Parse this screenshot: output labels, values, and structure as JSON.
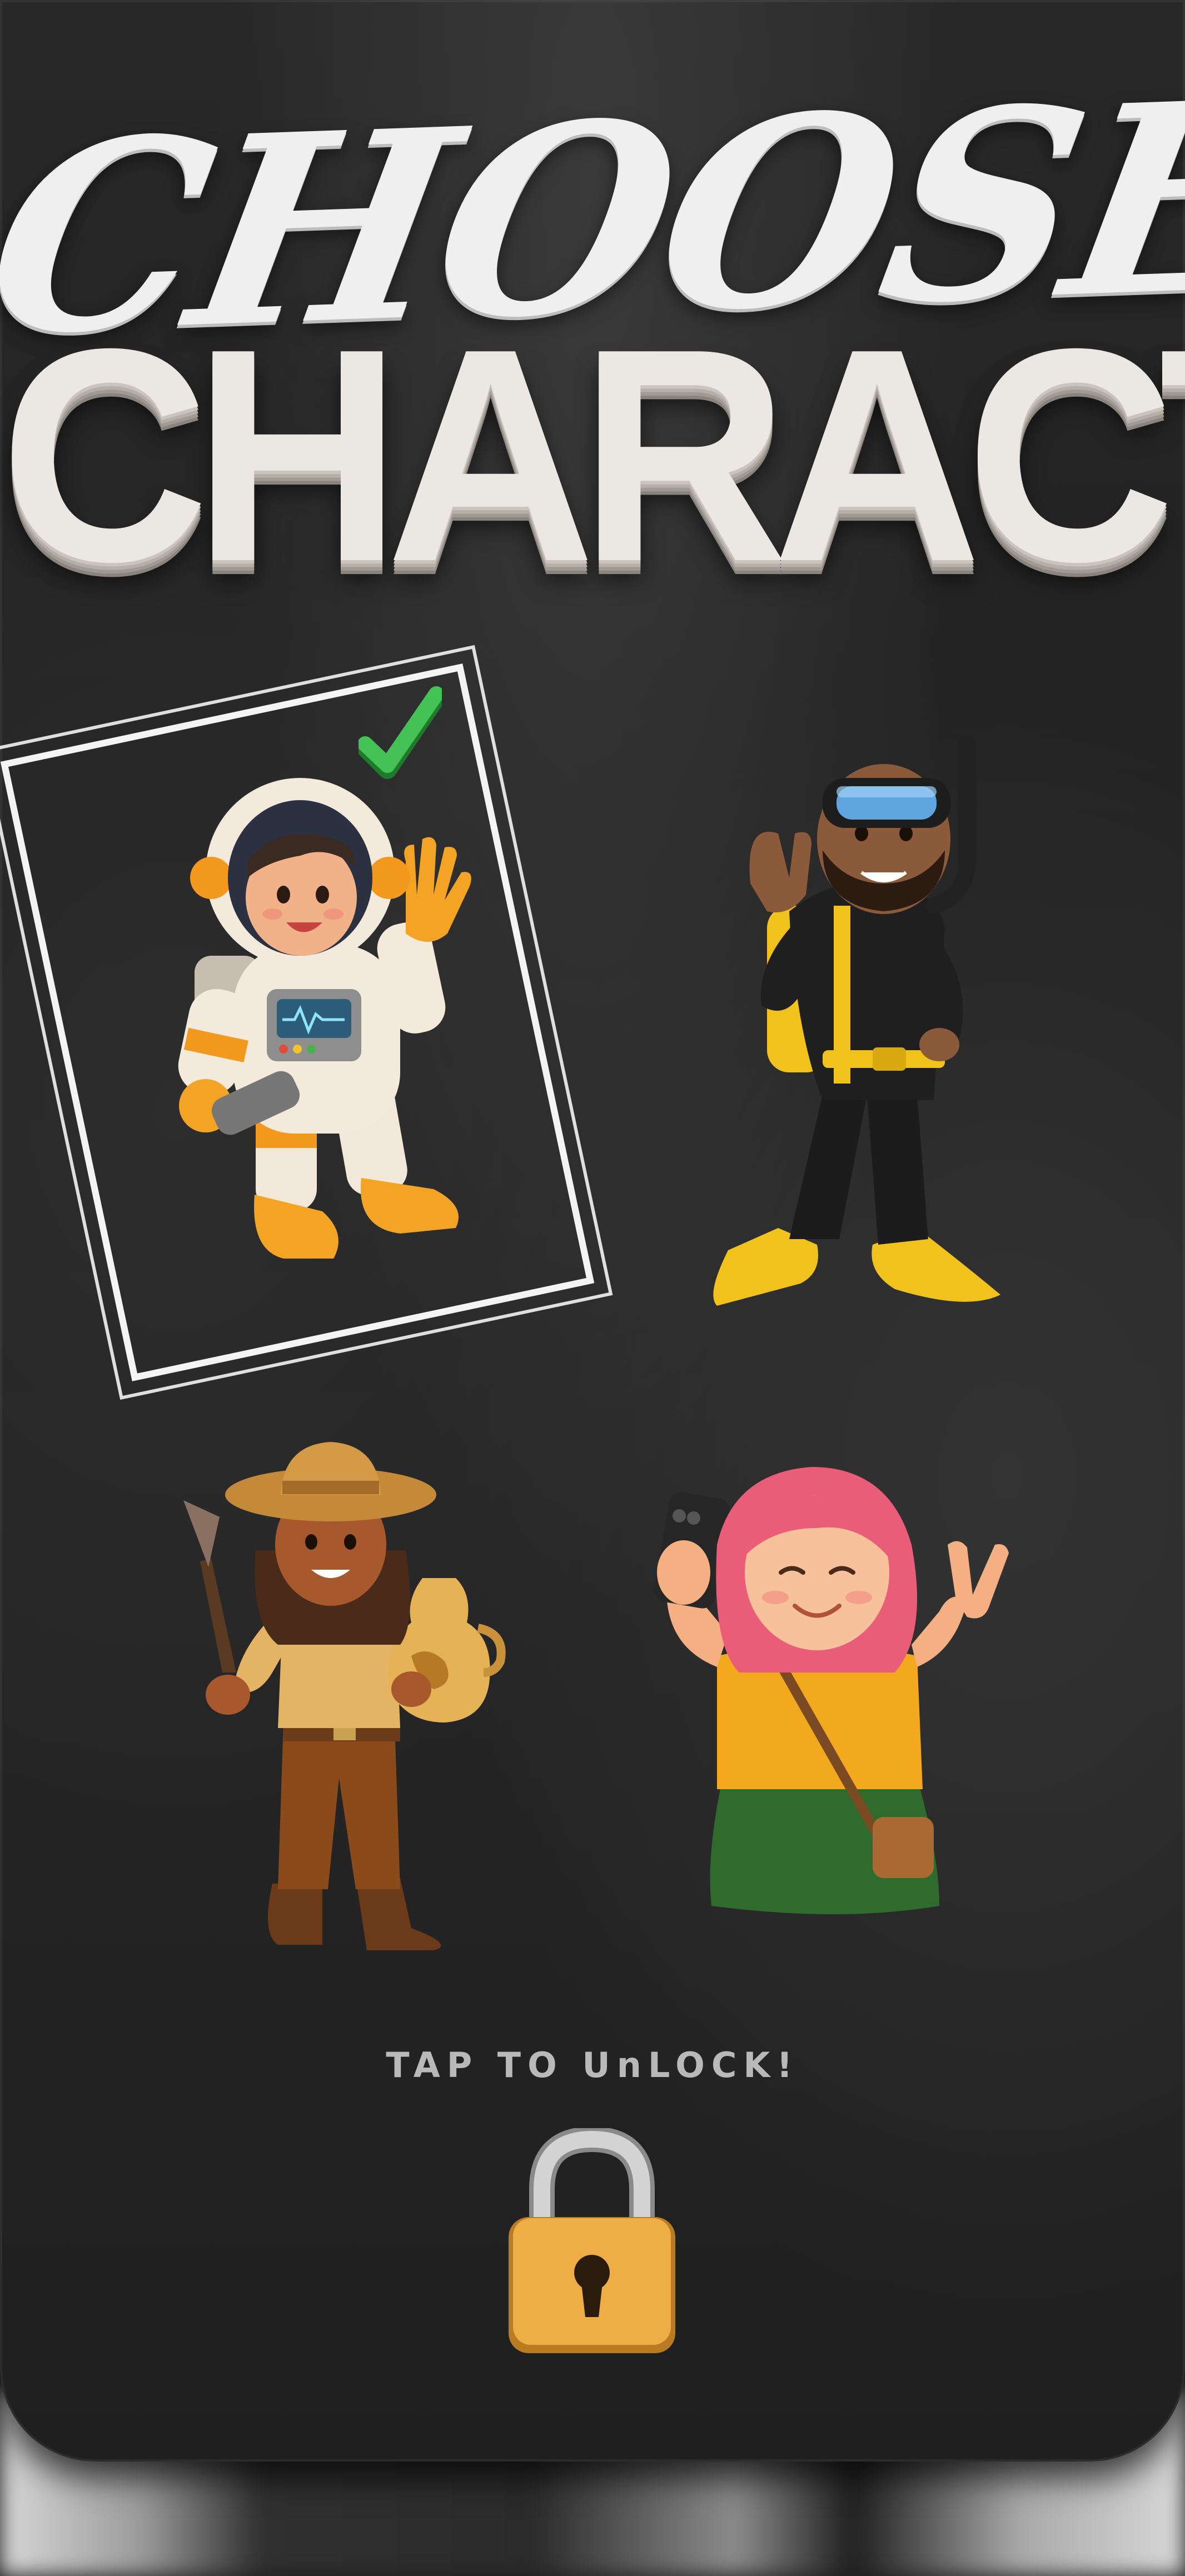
{
  "title": {
    "line1": "CHOOSE",
    "line2": "CHARACTER"
  },
  "characters": [
    {
      "id": "astronaut",
      "icon": "astronaut-character-icon",
      "selected": true
    },
    {
      "id": "diver",
      "icon": "scuba-diver-character-icon",
      "selected": false
    },
    {
      "id": "explorer",
      "icon": "archaeologist-character-icon",
      "selected": false
    },
    {
      "id": "selfie",
      "icon": "selfie-girl-character-icon",
      "selected": false
    }
  ],
  "unlock": {
    "label": "TAP TO UnLOCK!",
    "icon": "padlock-icon"
  },
  "colors": {
    "background": "#232323",
    "title": "#ebe8e4",
    "check": "#3bb84a",
    "lock_body": "#e8a63a",
    "lock_shackle": "#c8c8c8",
    "label": "#b9b9b9"
  }
}
